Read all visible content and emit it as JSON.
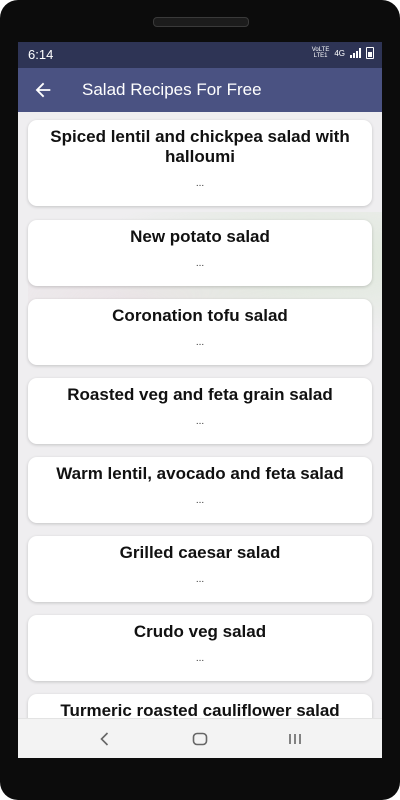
{
  "status_bar": {
    "time": "6:14",
    "network_top": "VoLTE",
    "network_bottom": "LTE1",
    "network_type": "4G"
  },
  "app_bar": {
    "title": "Salad Recipes For Free",
    "back_icon": "arrow-left-icon"
  },
  "recipes": [
    {
      "title": "Spiced lentil and chickpea salad with halloumi",
      "snippet": "..."
    },
    {
      "title": "New potato salad",
      "snippet": "..."
    },
    {
      "title": "Coronation tofu salad",
      "snippet": "..."
    },
    {
      "title": "Roasted veg and feta grain salad",
      "snippet": "..."
    },
    {
      "title": "Warm lentil, avocado and feta salad",
      "snippet": "..."
    },
    {
      "title": "Grilled caesar salad",
      "snippet": "..."
    },
    {
      "title": "Crudo veg salad",
      "snippet": "..."
    },
    {
      "title": "Turmeric roasted cauliflower salad",
      "snippet": "..."
    }
  ],
  "nav_bar": {
    "back": "back-chevron-icon",
    "home": "home-icon",
    "recents": "recents-icon"
  },
  "colors": {
    "status_bar": "#2e3455",
    "app_bar": "#4a5282",
    "background": "#efeef0",
    "card": "#ffffff"
  }
}
